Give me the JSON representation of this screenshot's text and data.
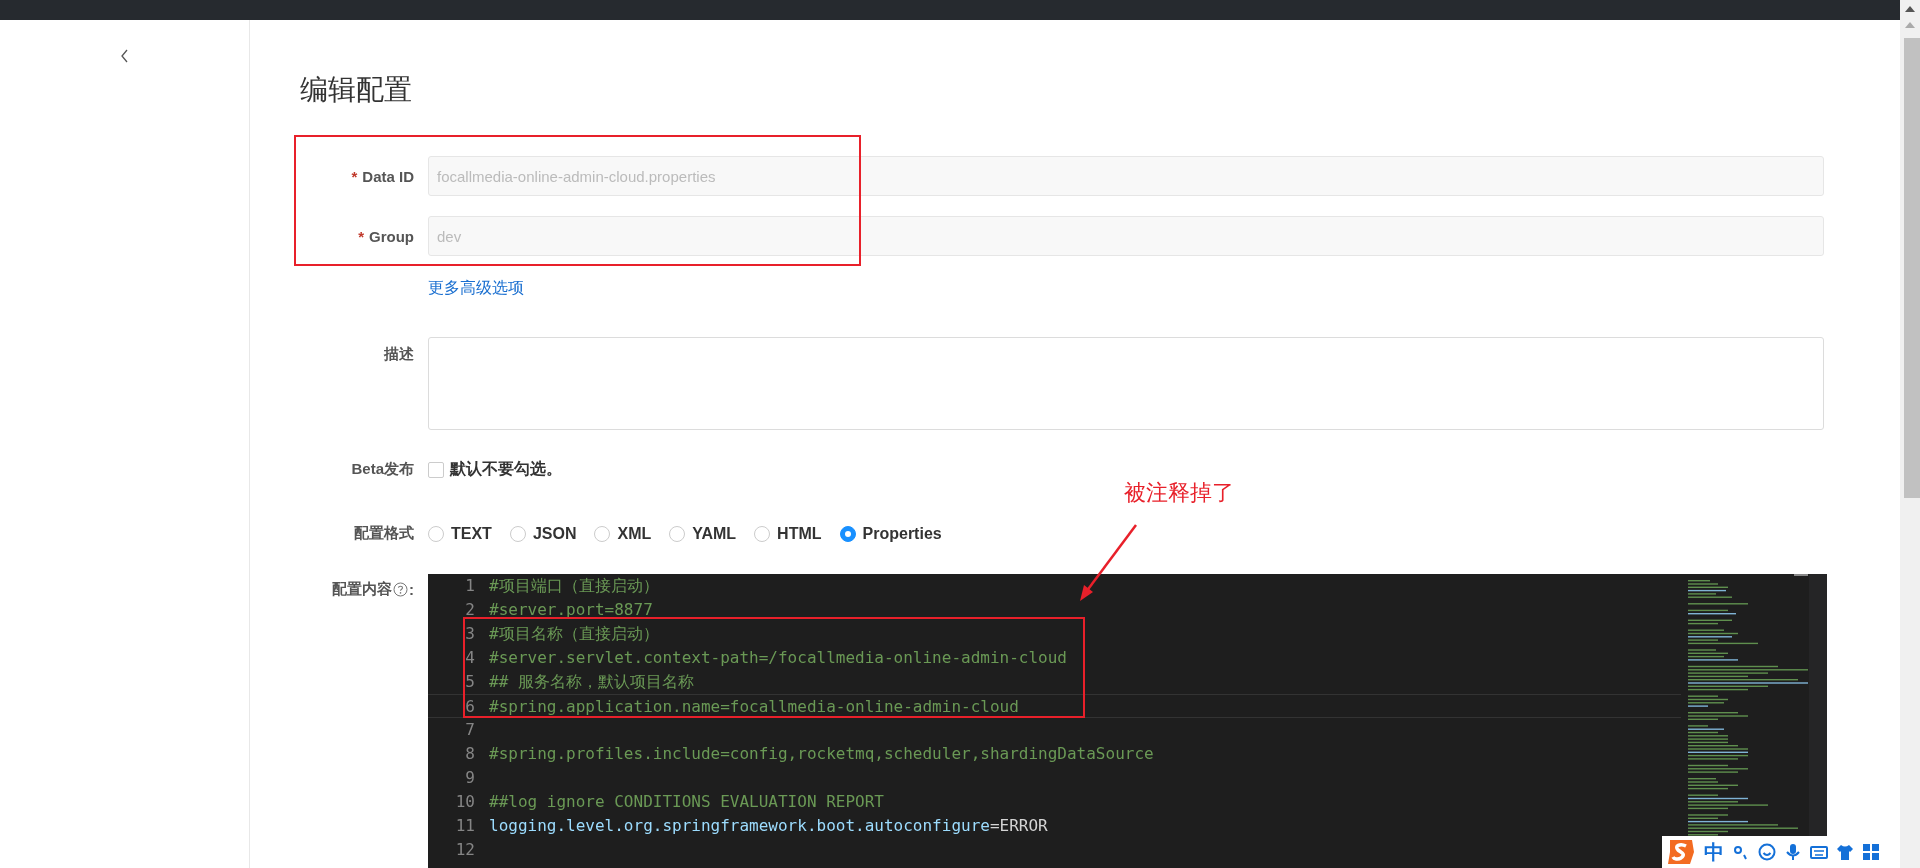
{
  "page_title": "编辑配置",
  "fields": [
    {
      "label": "Data ID",
      "required_mark": "*",
      "value": "focallmedia-online-admin-cloud.properties",
      "disabled": true
    },
    {
      "label": "Group",
      "required_mark": "*",
      "value": "dev",
      "disabled": true
    }
  ],
  "advanced_link": "更多高级选项",
  "description": {
    "label": "描述"
  },
  "beta": {
    "label": "Beta发布",
    "checked": false,
    "text": "默认不要勾选。"
  },
  "format": {
    "label": "配置格式",
    "options": [
      {
        "label": "TEXT",
        "selected": false
      },
      {
        "label": "JSON",
        "selected": false
      },
      {
        "label": "XML",
        "selected": false
      },
      {
        "label": "YAML",
        "selected": false
      },
      {
        "label": "HTML",
        "selected": false
      },
      {
        "label": "Properties",
        "selected": true
      }
    ]
  },
  "content": {
    "label": "配置内容",
    "suffix": ":",
    "lines": [
      {
        "number": "1",
        "kind": "comment",
        "text": "#项目端口（直接启动）",
        "active": false
      },
      {
        "number": "2",
        "kind": "comment",
        "text": "#server.port=8877",
        "active": false
      },
      {
        "number": "3",
        "kind": "comment",
        "text": "#项目名称（直接启动）",
        "active": false
      },
      {
        "number": "4",
        "kind": "comment",
        "text": "#server.servlet.context-path=/focallmedia-online-admin-cloud",
        "active": false
      },
      {
        "number": "5",
        "kind": "comment",
        "text": "## 服务名称，默认项目名称",
        "active": false
      },
      {
        "number": "6",
        "kind": "comment",
        "text": "#spring.application.name=focallmedia-online-admin-cloud",
        "active": true
      },
      {
        "number": "7",
        "kind": "blank",
        "active": false
      },
      {
        "number": "8",
        "kind": "comment",
        "text": "#spring.profiles.include=config,rocketmq,scheduler,shardingDataSource",
        "active": false
      },
      {
        "number": "9",
        "kind": "blank",
        "active": false
      },
      {
        "number": "10",
        "kind": "comment",
        "text": "##log ignore CONDITIONS EVALUATION REPORT",
        "active": false
      },
      {
        "number": "11",
        "kind": "property",
        "key": "logging.level.org.springframework.boot.autoconfigure",
        "sep": "=",
        "value": "ERROR",
        "active": false
      },
      {
        "number": "12",
        "kind": "blank",
        "active": false
      }
    ]
  },
  "annotation": {
    "text": "被注释掉了"
  },
  "ime_toolbar": {
    "mode": "中"
  }
}
